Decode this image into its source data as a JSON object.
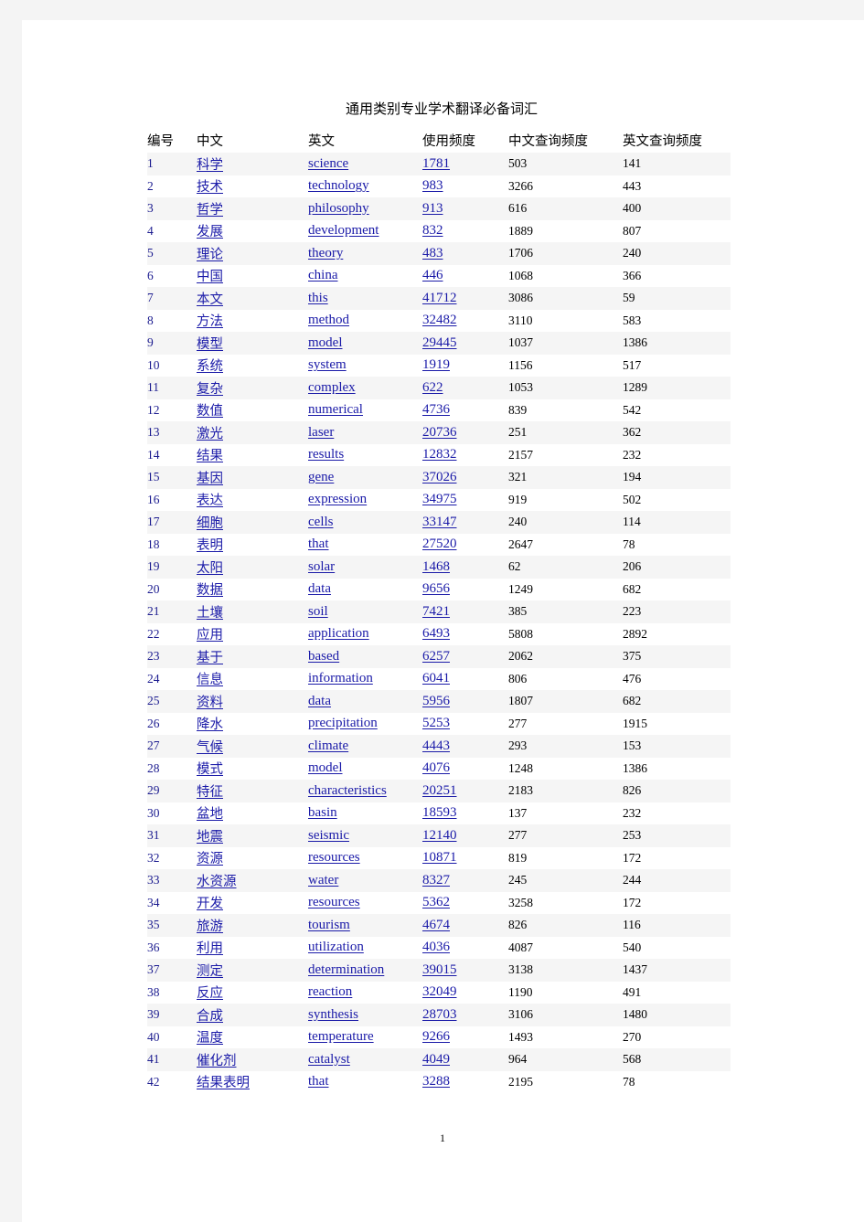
{
  "document": {
    "title": "通用类别专业学术翻译必备词汇",
    "page_number": "1",
    "link_color": "#1a1aa8",
    "stripe_color": "#f5f5f5",
    "page_background": "#ffffff",
    "canvas_background": "#f4f4f4"
  },
  "table": {
    "headers": [
      "编号",
      "中文",
      "英文",
      "使用频度",
      "中文查询频度",
      "英文查询频度"
    ],
    "rows": [
      {
        "no": "1",
        "zh": "科学",
        "en": "science",
        "use": "1781",
        "zhq": "503",
        "enq": "141"
      },
      {
        "no": "2",
        "zh": "技术",
        "en": "technology",
        "use": "983",
        "zhq": "3266",
        "enq": "443"
      },
      {
        "no": "3",
        "zh": "哲学",
        "en": "philosophy",
        "use": "913",
        "zhq": "616",
        "enq": "400"
      },
      {
        "no": "4",
        "zh": "发展",
        "en": "development",
        "use": "832",
        "zhq": "1889",
        "enq": "807"
      },
      {
        "no": "5",
        "zh": "理论",
        "en": "theory",
        "use": "483",
        "zhq": "1706",
        "enq": "240"
      },
      {
        "no": "6",
        "zh": "中国",
        "en": "china",
        "use": "446",
        "zhq": "1068",
        "enq": "366"
      },
      {
        "no": "7",
        "zh": "本文",
        "en": "this",
        "use": "41712",
        "zhq": "3086",
        "enq": "59"
      },
      {
        "no": "8",
        "zh": "方法",
        "en": "method",
        "use": "32482",
        "zhq": "3110",
        "enq": "583"
      },
      {
        "no": "9",
        "zh": "模型",
        "en": "model",
        "use": "29445",
        "zhq": "1037",
        "enq": "1386"
      },
      {
        "no": "10",
        "zh": "系统",
        "en": "system",
        "use": "1919",
        "zhq": "1156",
        "enq": "517"
      },
      {
        "no": "11",
        "zh": "复杂",
        "en": "complex",
        "use": "622",
        "zhq": "1053",
        "enq": "1289"
      },
      {
        "no": "12",
        "zh": "数值",
        "en": "numerical",
        "use": "4736",
        "zhq": "839",
        "enq": "542"
      },
      {
        "no": "13",
        "zh": "激光",
        "en": "laser",
        "use": "20736",
        "zhq": "251",
        "enq": "362"
      },
      {
        "no": "14",
        "zh": "结果",
        "en": "results",
        "use": "12832",
        "zhq": "2157",
        "enq": "232"
      },
      {
        "no": "15",
        "zh": "基因",
        "en": "gene",
        "use": "37026",
        "zhq": "321",
        "enq": "194"
      },
      {
        "no": "16",
        "zh": "表达",
        "en": "expression",
        "use": "34975",
        "zhq": "919",
        "enq": "502"
      },
      {
        "no": "17",
        "zh": "细胞",
        "en": "cells",
        "use": "33147",
        "zhq": "240",
        "enq": "114"
      },
      {
        "no": "18",
        "zh": "表明",
        "en": "that",
        "use": "27520",
        "zhq": "2647",
        "enq": "78"
      },
      {
        "no": "19",
        "zh": "太阳",
        "en": "solar",
        "use": "1468",
        "zhq": "62",
        "enq": "206"
      },
      {
        "no": "20",
        "zh": "数据",
        "en": "data",
        "use": "9656",
        "zhq": "1249",
        "enq": "682"
      },
      {
        "no": "21",
        "zh": "土壤",
        "en": "soil",
        "use": "7421",
        "zhq": "385",
        "enq": "223"
      },
      {
        "no": "22",
        "zh": "应用",
        "en": "application",
        "use": "6493",
        "zhq": "5808",
        "enq": "2892"
      },
      {
        "no": "23",
        "zh": "基于",
        "en": "based",
        "use": "6257",
        "zhq": "2062",
        "enq": "375"
      },
      {
        "no": "24",
        "zh": "信息",
        "en": "information",
        "use": "6041",
        "zhq": "806",
        "enq": "476"
      },
      {
        "no": "25",
        "zh": "资料",
        "en": "data",
        "use": "5956",
        "zhq": "1807",
        "enq": "682"
      },
      {
        "no": "26",
        "zh": "降水",
        "en": "precipitation",
        "use": "5253",
        "zhq": "277",
        "enq": "1915"
      },
      {
        "no": "27",
        "zh": "气候",
        "en": "climate",
        "use": "4443",
        "zhq": "293",
        "enq": "153"
      },
      {
        "no": "28",
        "zh": "模式",
        "en": "model",
        "use": "4076",
        "zhq": "1248",
        "enq": "1386"
      },
      {
        "no": "29",
        "zh": "特征",
        "en": "characteristics",
        "use": "20251",
        "zhq": "2183",
        "enq": "826"
      },
      {
        "no": "30",
        "zh": "盆地",
        "en": "basin",
        "use": "18593",
        "zhq": "137",
        "enq": "232"
      },
      {
        "no": "31",
        "zh": "地震",
        "en": "seismic",
        "use": "12140",
        "zhq": "277",
        "enq": "253"
      },
      {
        "no": "32",
        "zh": "资源",
        "en": "resources",
        "use": "10871",
        "zhq": "819",
        "enq": "172"
      },
      {
        "no": "33",
        "zh": "水资源",
        "en": "water",
        "use": "8327",
        "zhq": "245",
        "enq": "244"
      },
      {
        "no": "34",
        "zh": "开发",
        "en": "resources",
        "use": "5362",
        "zhq": "3258",
        "enq": "172"
      },
      {
        "no": "35",
        "zh": "旅游",
        "en": "tourism",
        "use": "4674",
        "zhq": "826",
        "enq": "116"
      },
      {
        "no": "36",
        "zh": "利用",
        "en": "utilization",
        "use": "4036",
        "zhq": "4087",
        "enq": "540"
      },
      {
        "no": "37",
        "zh": "测定",
        "en": "determination",
        "use": "39015",
        "zhq": "3138",
        "enq": "1437"
      },
      {
        "no": "38",
        "zh": "反应",
        "en": "reaction",
        "use": "32049",
        "zhq": "1190",
        "enq": "491"
      },
      {
        "no": "39",
        "zh": "合成",
        "en": "synthesis",
        "use": "28703",
        "zhq": "3106",
        "enq": "1480"
      },
      {
        "no": "40",
        "zh": "温度",
        "en": "temperature",
        "use": "9266",
        "zhq": "1493",
        "enq": "270"
      },
      {
        "no": "41",
        "zh": "催化剂",
        "en": "catalyst",
        "use": "4049",
        "zhq": "964",
        "enq": "568"
      },
      {
        "no": "42",
        "zh": "结果表明",
        "en": "that",
        "use": "3288",
        "zhq": "2195",
        "enq": "78"
      }
    ]
  }
}
